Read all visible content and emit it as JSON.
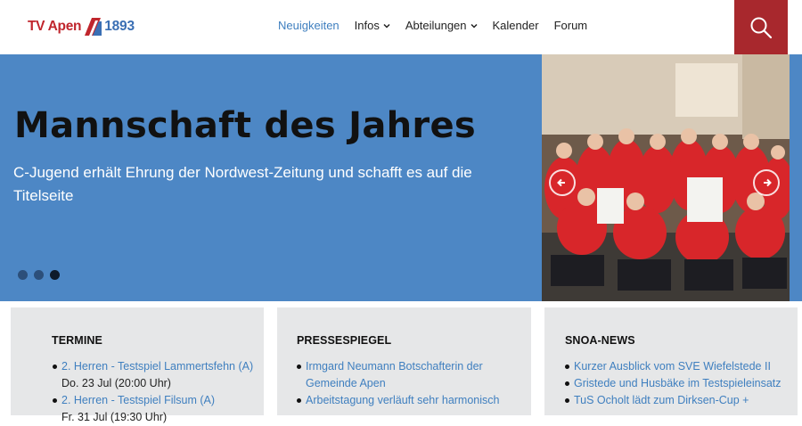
{
  "header": {
    "logo": {
      "left": "TV Apen",
      "right": "1893"
    },
    "nav": [
      {
        "label": "Neuigkeiten",
        "active": true,
        "dropdown": false
      },
      {
        "label": "Infos",
        "active": false,
        "dropdown": true
      },
      {
        "label": "Abteilungen",
        "active": false,
        "dropdown": true
      },
      {
        "label": "Kalender",
        "active": false,
        "dropdown": false
      },
      {
        "label": "Forum",
        "active": false,
        "dropdown": false
      }
    ],
    "search_icon": "search-icon"
  },
  "hero": {
    "title": "Mannschaft des Jahres",
    "subtitle": "C-Jugend erhält Ehrung der Nordwest-Zeitung und schafft es auf die Titelseite",
    "slides_count": 3,
    "active_slide": 3
  },
  "cards": [
    {
      "title": "TERMINE",
      "items": [
        {
          "link": "2. Herren - Testspiel Lammertsfehn (A)",
          "sub": "Do. 23 Jul (20:00 Uhr)"
        },
        {
          "link": "2. Herren - Testspiel Filsum (A)",
          "sub": "Fr. 31 Jul (19:30 Uhr)"
        }
      ]
    },
    {
      "title": "PRESSESPIEGEL",
      "items": [
        {
          "link": "Irmgard Neumann Botschafterin der Gemeinde Apen",
          "sub": ""
        },
        {
          "link": "Arbeitstagung verläuft sehr harmonisch",
          "sub": ""
        }
      ]
    },
    {
      "title": "SNOA-NEWS",
      "items": [
        {
          "link": "Kurzer Ausblick vom SVE Wiefelstede II",
          "sub": ""
        },
        {
          "link": "Gristede und Husbäke im Testspieleinsatz",
          "sub": ""
        },
        {
          "link": "TuS Ocholt lädt zum Dirksen-Cup +",
          "sub": ""
        }
      ]
    }
  ],
  "colors": {
    "brand_red": "#a8282d",
    "hero_blue": "#4d87c5",
    "link_blue": "#3f7fbf",
    "card_bg": "#e6e7e8"
  }
}
